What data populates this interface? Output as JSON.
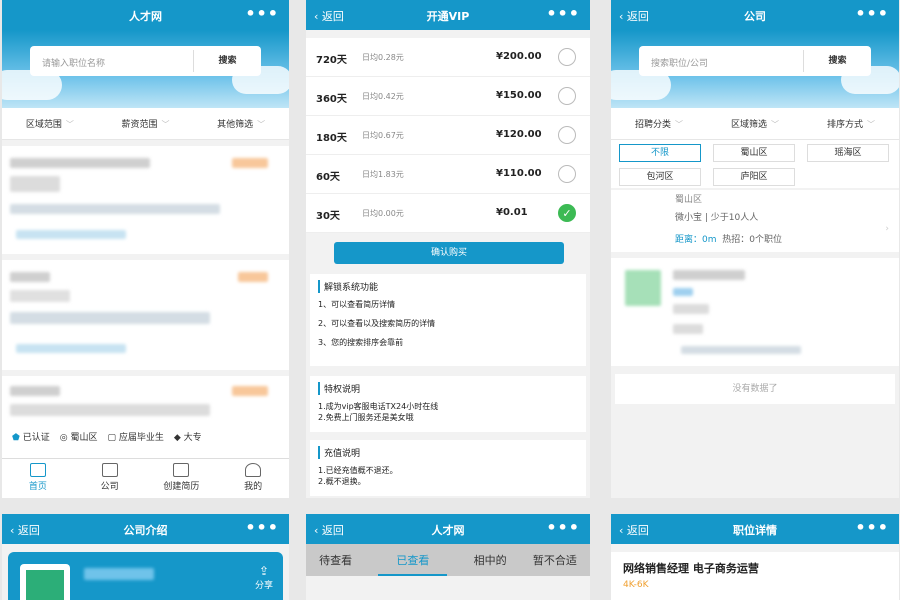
{
  "screen1": {
    "title": "人才网",
    "menu": "•••",
    "search": {
      "placeholder": "请输入职位名称",
      "button": "搜索"
    },
    "filters": [
      "区域范围",
      "薪资范围",
      "其他筛选"
    ],
    "tags": [
      "已认证",
      "蜀山区",
      "应届毕业生",
      "大专"
    ],
    "tabs": [
      "首页",
      "公司",
      "创建简历",
      "我的"
    ]
  },
  "screen2": {
    "back": "返回",
    "title": "开通VIP",
    "menu": "•••",
    "plans": [
      {
        "days": "720天",
        "avg": "日均0.28元",
        "price": "¥200.00",
        "selected": false
      },
      {
        "days": "360天",
        "avg": "日均0.42元",
        "price": "¥150.00",
        "selected": false
      },
      {
        "days": "180天",
        "avg": "日均0.67元",
        "price": "¥120.00",
        "selected": false
      },
      {
        "days": "60天",
        "avg": "日均1.83元",
        "price": "¥110.00",
        "selected": false
      },
      {
        "days": "30天",
        "avg": "日均0.00元",
        "price": "¥0.01",
        "selected": true
      }
    ],
    "confirm": "确认购买",
    "features": {
      "title": "解锁系统功能",
      "items": [
        "1、可以查看简历详情",
        "2、可以查看以及搜索简历的详情",
        "3、您的搜索排序会靠前"
      ]
    },
    "privilege": {
      "title": "特权说明",
      "items": [
        "1.成为vip客服电话TX24小时在线",
        "2.免费上门服务还是美女哦"
      ]
    },
    "recharge": {
      "title": "充值说明",
      "items": [
        "1.已经充值概不退还。",
        "2.概不退换。"
      ]
    }
  },
  "screen3": {
    "back": "返回",
    "title": "公司",
    "menu": "•••",
    "search": {
      "placeholder": "搜索职位/公司",
      "button": "搜索"
    },
    "filters": [
      "招聘分类",
      "区域筛选",
      "排序方式"
    ],
    "cats": [
      "不限",
      "蜀山区",
      "瑶海区",
      "包河区",
      "庐阳区"
    ],
    "company": {
      "district": "蜀山区",
      "info": "微小宝 | 少于10人人",
      "distance": "距离：0m",
      "hot": "热招：0个职位"
    },
    "nomore": "没有数据了"
  },
  "screen4": {
    "back": "返回",
    "title": "公司介绍",
    "menu": "•••",
    "share": "分享"
  },
  "screen5": {
    "back": "返回",
    "title": "人才网",
    "menu": "•••",
    "tabs": [
      "待查看",
      "已查看",
      "相中的",
      "暂不合适"
    ]
  },
  "screen6": {
    "back": "返回",
    "title": "职位详情",
    "menu": "•••",
    "job": "网络销售经理 电子商务运营",
    "salary": "4K-6K"
  }
}
